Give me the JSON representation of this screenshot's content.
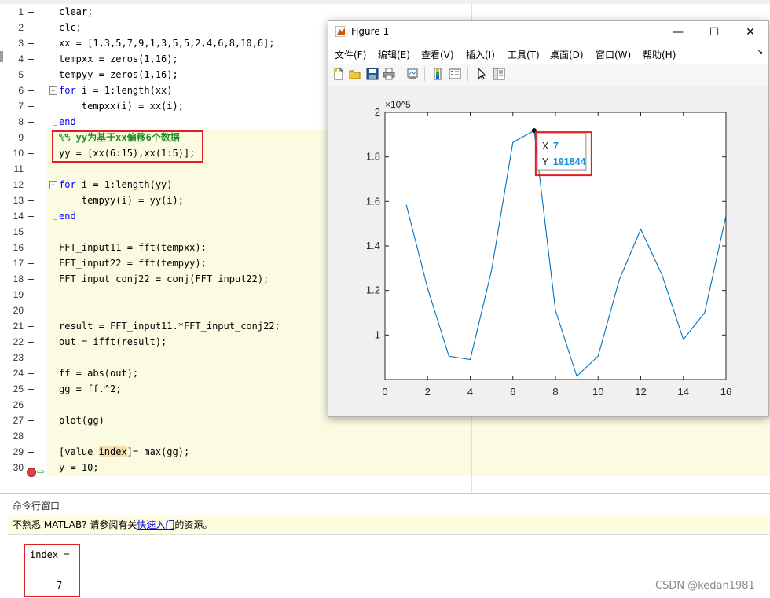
{
  "editor": {
    "lines": [
      {
        "n": "1",
        "code": "clear;"
      },
      {
        "n": "2",
        "code": "clc;"
      },
      {
        "n": "3",
        "code": "xx = [1,3,5,7,9,1,3,5,5,2,4,6,8,10,6];"
      },
      {
        "n": "4",
        "code": "tempxx = zeros(1,16);"
      },
      {
        "n": "5",
        "code": "tempyy = zeros(1,16);"
      },
      {
        "n": "6",
        "kw": "for",
        "code": " i = 1:length(xx)"
      },
      {
        "n": "7",
        "code": "    tempxx(i) = xx(i);"
      },
      {
        "n": "8",
        "kw": "end",
        "code": ""
      },
      {
        "n": "9",
        "comment": "%% yy为基于xx偏移6个数据"
      },
      {
        "n": "10",
        "code": "yy = [xx(6:15),xx(1:5)];"
      },
      {
        "n": "11",
        "code": ""
      },
      {
        "n": "12",
        "kw": "for",
        "code": " i = 1:length(yy)"
      },
      {
        "n": "13",
        "code": "    tempyy(i) = yy(i);"
      },
      {
        "n": "14",
        "kw": "end",
        "code": ""
      },
      {
        "n": "15",
        "code": ""
      },
      {
        "n": "16",
        "code": "FFT_input11 = fft(tempxx);"
      },
      {
        "n": "17",
        "code": "FFT_input22 = fft(tempyy);"
      },
      {
        "n": "18",
        "code": "FFT_input_conj22 = conj(FFT_input22);"
      },
      {
        "n": "19",
        "code": ""
      },
      {
        "n": "20",
        "code": ""
      },
      {
        "n": "21",
        "code": "result = FFT_input11.*FFT_input_conj22;"
      },
      {
        "n": "22",
        "code": "out = ifft(result);"
      },
      {
        "n": "23",
        "code": ""
      },
      {
        "n": "24",
        "code": "ff = abs(out);"
      },
      {
        "n": "25",
        "code": "gg = ff.^2;"
      },
      {
        "n": "26",
        "code": ""
      },
      {
        "n": "27",
        "code": "plot(gg)"
      },
      {
        "n": "28",
        "code": ""
      },
      {
        "n": "29",
        "pre": "[value ",
        "hl": "index",
        "post": "]= max(gg);"
      },
      {
        "n": "30",
        "code": "y = 10;"
      }
    ]
  },
  "command_window": {
    "title": "命令行窗口",
    "notice_prefix": "不熟悉 MATLAB? 请参阅有关",
    "notice_link": "快速入门",
    "notice_suffix": "的资源。",
    "output_var": "index =",
    "output_value": "7"
  },
  "watermark": "CSDN @kedan1981",
  "figure": {
    "title": "Figure 1",
    "menus": [
      "文件(F)",
      "编辑(E)",
      "查看(V)",
      "插入(I)",
      "工具(T)",
      "桌面(D)",
      "窗口(W)",
      "帮助(H)"
    ],
    "toolbar_icons": [
      "new-figure-icon",
      "open-file-icon",
      "save-icon",
      "print-icon",
      "link-plot-icon",
      "colorbar-icon",
      "legend-icon",
      "pointer-icon",
      "property-inspector-icon"
    ],
    "datatip": {
      "x_label": "X",
      "x_value": "7",
      "y_label": "Y",
      "y_value": "191844"
    },
    "line_color": "#0072bd",
    "datatip_color": "#1a8fd6",
    "highlight_color": "#e02020"
  },
  "chart_data": {
    "type": "line",
    "x": [
      1,
      2,
      3,
      4,
      5,
      6,
      7,
      8,
      9,
      10,
      11,
      12,
      13,
      14,
      15,
      16
    ],
    "series": [
      {
        "values": [
          158500,
          121000,
          90500,
          89000,
          129000,
          186500,
          191844,
          111000,
          81500,
          90500,
          125000,
          147500,
          127000,
          98000,
          110000,
          153500
        ]
      }
    ],
    "xlim": [
      0,
      16
    ],
    "ylim": [
      80000,
      200000
    ],
    "xticks": [
      "0",
      "2",
      "4",
      "6",
      "8",
      "10",
      "12",
      "14",
      "16"
    ],
    "yticks": [
      "1",
      "1.2",
      "1.4",
      "1.6",
      "1.8",
      "2"
    ],
    "y_exponent": "×10^5",
    "grid": false
  }
}
